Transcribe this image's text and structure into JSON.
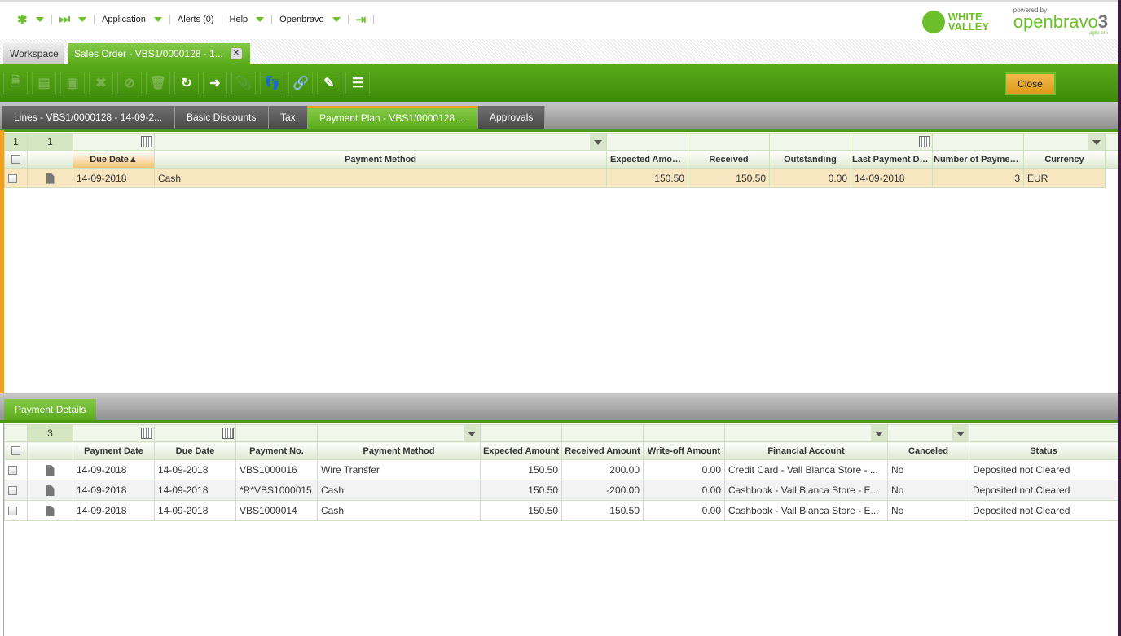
{
  "nav": {
    "items": [
      {
        "label": "Application"
      },
      {
        "label": "Alerts (0)"
      },
      {
        "label": "Help"
      },
      {
        "label": "Openbravo"
      }
    ]
  },
  "logos": {
    "white_valley": "WHITE VALLEY",
    "powered_by": "powered by",
    "openbravo": "openbravo",
    "version": "3",
    "tagline": "agile erp"
  },
  "window_tabs": [
    {
      "label": "Workspace"
    },
    {
      "label": "Sales Order - VBS1/0000128 - 1..."
    }
  ],
  "toolbar": {
    "buttons": [
      "new-document",
      "new-row",
      "save",
      "undo",
      "cancel",
      "delete",
      "refresh",
      "export",
      "attach",
      "audit-trail",
      "link",
      "customize",
      "toggle-view"
    ],
    "close_label": "Close"
  },
  "subtabs": [
    {
      "label": "Lines - VBS1/0000128 - 14-09-2..."
    },
    {
      "label": "Basic Discounts"
    },
    {
      "label": "Tax"
    },
    {
      "label": "Payment Plan - VBS1/0000128 ..."
    },
    {
      "label": "Approvals"
    }
  ],
  "plan": {
    "selected_count": "1",
    "total_count": "1",
    "columns": [
      "Due Date",
      "Payment Method",
      "Expected Amount",
      "Received",
      "Outstanding",
      "Last Payment Date",
      "Number of Payments",
      "Currency"
    ],
    "sort_indicator": "▲",
    "rows": [
      [
        "14-09-2018",
        "Cash",
        "150.50",
        "150.50",
        "0.00",
        "14-09-2018",
        "3",
        "EUR"
      ]
    ]
  },
  "details": {
    "tab_label": "Payment Details",
    "total_count": "3",
    "columns": [
      "Payment Date",
      "Due Date",
      "Payment No.",
      "Payment Method",
      "Expected Amount",
      "Received Amount",
      "Write-off Amount",
      "Financial Account",
      "Canceled",
      "Status"
    ],
    "rows": [
      [
        "14-09-2018",
        "14-09-2018",
        "VBS1000016",
        "Wire Transfer",
        "150.50",
        "200.00",
        "0.00",
        "Credit Card - Vall Blanca Store - ...",
        "No",
        "Deposited not Cleared"
      ],
      [
        "14-09-2018",
        "14-09-2018",
        "*R*VBS1000015",
        "Cash",
        "150.50",
        "-200.00",
        "0.00",
        "Cashbook - Vall Blanca Store - E...",
        "No",
        "Deposited not Cleared"
      ],
      [
        "14-09-2018",
        "14-09-2018",
        "VBS1000014",
        "Cash",
        "150.50",
        "150.50",
        "0.00",
        "Cashbook - Vall Blanca Store - E...",
        "No",
        "Deposited not Cleared"
      ]
    ]
  },
  "colors": {
    "accent": "#6cbf2a",
    "toolbar": "#4d9a12",
    "selected_row": "#f7e6c0",
    "close_button": "#e5a42a"
  }
}
